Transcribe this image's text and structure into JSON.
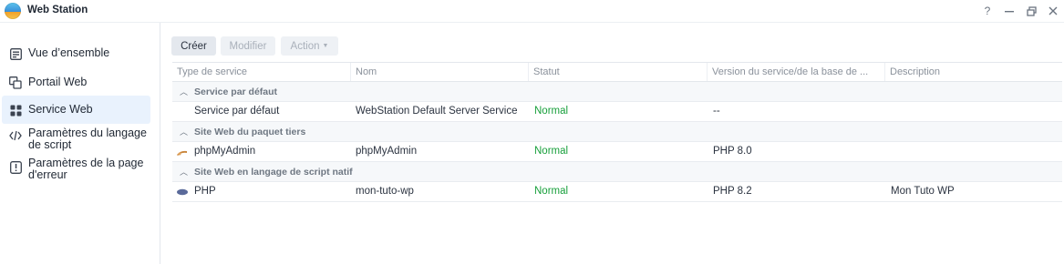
{
  "window": {
    "title": "Web Station",
    "controls": {
      "help": "?",
      "minimize": "—",
      "restore": "⧉",
      "close": "✕"
    }
  },
  "sidebar": {
    "items": [
      {
        "label": "Vue d’ensemble",
        "icon": "list-panel-icon",
        "active": false
      },
      {
        "label": "Portail Web",
        "icon": "portal-icon",
        "active": false
      },
      {
        "label": "Service Web",
        "icon": "grid-icon",
        "active": true
      },
      {
        "label": "Paramètres du langage de script",
        "icon": "code-icon",
        "active": false
      },
      {
        "label": "Paramètres de la page d'erreur",
        "icon": "error-icon",
        "active": false
      }
    ]
  },
  "toolbar": {
    "create_label": "Créer",
    "modify_label": "Modifier",
    "action_label": "Action"
  },
  "table": {
    "columns": [
      "Type de service",
      "Nom",
      "Statut",
      "Version du service/de la base de ...",
      "Description"
    ],
    "groups": [
      {
        "label": "Service par défaut",
        "rows": [
          {
            "type": "Service par défaut",
            "name": "WebStation Default Server Service",
            "status": "Normal",
            "version": "--",
            "description": "",
            "icon": ""
          }
        ]
      },
      {
        "label": "Site Web du paquet tiers",
        "rows": [
          {
            "type": "phpMyAdmin",
            "name": "phpMyAdmin",
            "status": "Normal",
            "version": "PHP 8.0",
            "description": "",
            "icon": "phpmyadmin-icon"
          }
        ]
      },
      {
        "label": "Site Web en langage de script natif",
        "rows": [
          {
            "type": "PHP",
            "name": "mon-tuto-wp",
            "status": "Normal",
            "version": "PHP 8.2",
            "description": "Mon Tuto WP",
            "icon": "php-icon"
          }
        ]
      }
    ]
  },
  "colors": {
    "status_ok": "#19a03c",
    "active_nav": "#e9f2fd"
  }
}
